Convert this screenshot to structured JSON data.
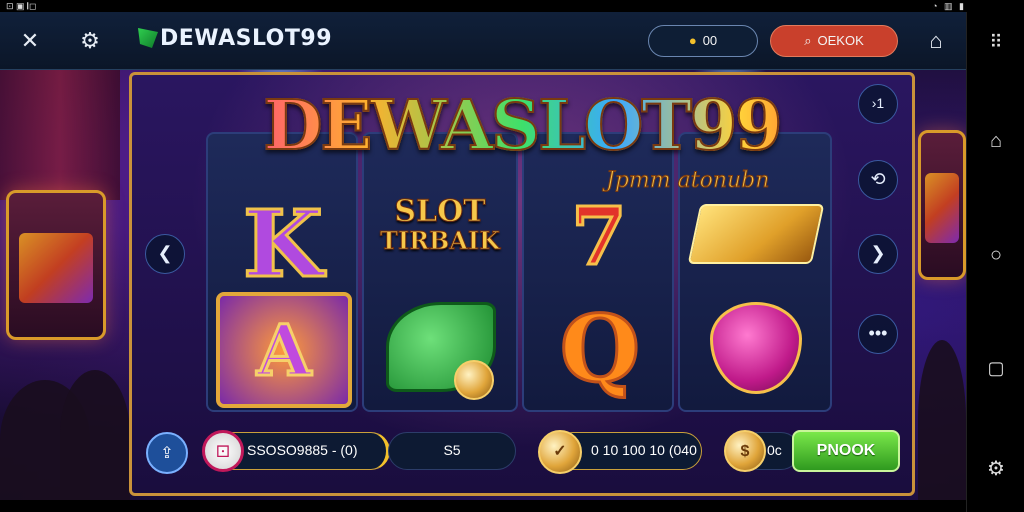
{
  "status_bar": {
    "left": "⊡ ▣ 𝄃◻︎",
    "right": "◔ ▥ ▮"
  },
  "header": {
    "close_icon": "close-icon",
    "settings_icon": "gear-icon",
    "logo_text": "DEWASLOT99",
    "balance": "00",
    "search_label": "OEKOK",
    "home_icon": "home-icon",
    "menu_icon": "grid-icon"
  },
  "game": {
    "title": "DEWASLOT99",
    "subtitle": "Jpmm atonubn",
    "tag_line1": "SLOT",
    "tag_line2": "TIRBAIK",
    "reels": [
      {
        "top": "K",
        "bottom": "A"
      },
      {
        "top": "tag",
        "bottom": "leaf"
      },
      {
        "top": "7",
        "bottom": "Q"
      },
      {
        "top": "gold-bar",
        "bottom": "heart"
      }
    ]
  },
  "controls": {
    "bet_info": "SSOSO9885 - (0)",
    "bet_value": "S5",
    "win_info": "0 10 100 10 (040",
    "credit_value": "0c",
    "spin_label": "PNOOK"
  },
  "colors": {
    "accent": "#c9923a",
    "spin": "#3fae2a",
    "search": "#c9402c"
  }
}
